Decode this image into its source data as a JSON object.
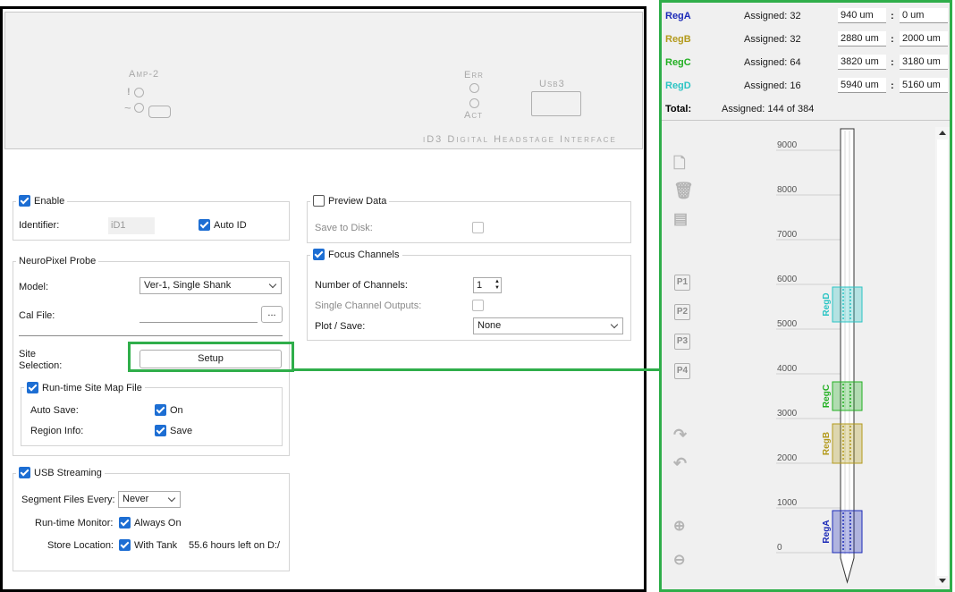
{
  "device": {
    "amp_label": "Amp-2",
    "amp_led1": "!",
    "amp_led2": "~",
    "err_label": "Err",
    "act_label": "Act",
    "usb_label": "Usb3",
    "name": "iD3 Digital Headstage Interface"
  },
  "enable_group": {
    "title": "Enable",
    "checked": true,
    "identifier_label": "Identifier:",
    "identifier_value": "iD1",
    "auto_id_label": "Auto ID",
    "auto_id_checked": true
  },
  "probe_group": {
    "title": "NeuroPixel Probe",
    "model_label": "Model:",
    "model_value": "Ver-1, Single Shank",
    "cal_label": "Cal File:",
    "cal_value": "",
    "browse_label": "...",
    "site_label_line1": "Site",
    "site_label_line2": "Selection:",
    "setup_label": "Setup"
  },
  "runtime_group": {
    "title": "Run-time Site Map File",
    "checked": true,
    "autosave_label": "Auto Save:",
    "autosave_value": "On",
    "region_label": "Region Info:",
    "region_value": "Save"
  },
  "usb_group": {
    "title": "USB Streaming",
    "checked": true,
    "segment_label": "Segment Files Every:",
    "segment_value": "Never",
    "monitor_label": "Run-time Monitor:",
    "monitor_value": "Always On",
    "store_label": "Store Location:",
    "store_value": "With Tank",
    "store_info": "55.6 hours left on D:/"
  },
  "preview_group": {
    "title": "Preview Data",
    "checked": false,
    "save_label": "Save to Disk:"
  },
  "focus_group": {
    "title": "Focus Channels",
    "checked": true,
    "num_label": "Number of Channels:",
    "num_value": "1",
    "single_label": "Single Channel Outputs:",
    "plot_label": "Plot / Save:",
    "plot_value": "None"
  },
  "regions": [
    {
      "name": "RegA",
      "assigned": "Assigned: 32",
      "top": "940 um",
      "bottom": "0 um",
      "color": "#1d2bb8"
    },
    {
      "name": "RegB",
      "assigned": "Assigned: 32",
      "top": "2880 um",
      "bottom": "2000 um",
      "color": "#b39a1c"
    },
    {
      "name": "RegC",
      "assigned": "Assigned: 64",
      "top": "3820 um",
      "bottom": "3180 um",
      "color": "#22b022"
    },
    {
      "name": "RegD",
      "assigned": "Assigned: 16",
      "top": "5940 um",
      "bottom": "5160 um",
      "color": "#2cc4c4"
    }
  ],
  "region_colon": ":",
  "total": {
    "label": "Total:",
    "assigned": "Assigned: 144 of 384"
  },
  "probe_axis": {
    "ticks": [
      "9000",
      "8000",
      "7000",
      "6000",
      "5000",
      "4000",
      "3000",
      "2000",
      "1000",
      "0"
    ]
  },
  "probe_buttons": {
    "p1": "P1",
    "p2": "P2",
    "p3": "P3",
    "p4": "P4"
  },
  "accent_green": "#2fae4a"
}
